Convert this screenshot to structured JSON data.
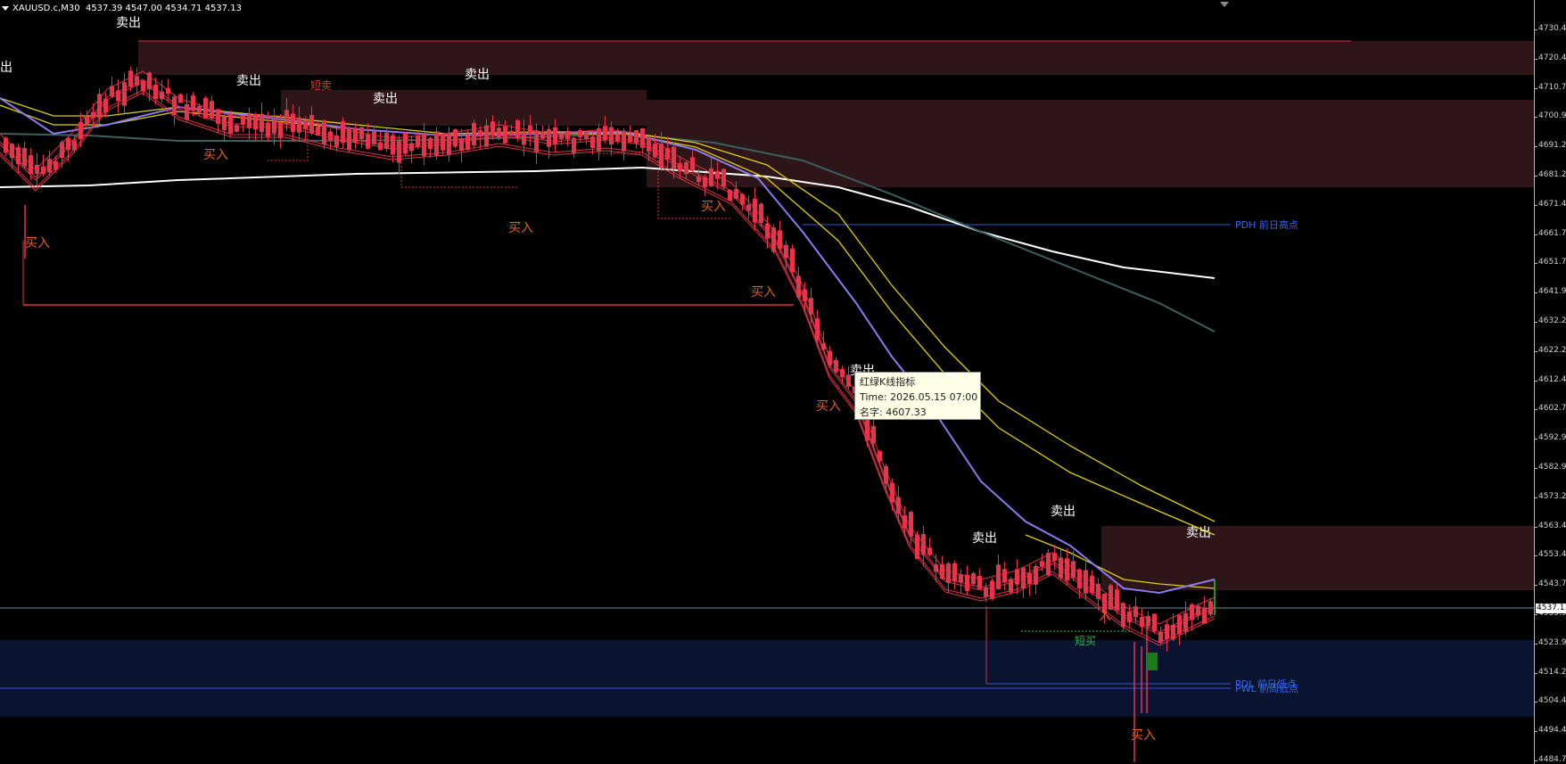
{
  "symbol": {
    "name": "XAUUSD.c,M30",
    "open": "4537.39",
    "high": "4547.00",
    "low": "4534.71",
    "close": "4537.13"
  },
  "price_axis": {
    "labels": [
      "4730.45",
      "4720.45",
      "4710.70",
      "4700.95",
      "4691.20",
      "4681.20",
      "4671.45",
      "4661.70",
      "4651.70",
      "4641.95",
      "4632.20",
      "4622.20",
      "4612.45",
      "4602.70",
      "4592.95",
      "4582.95",
      "4573.20",
      "4563.45",
      "4553.45",
      "4543.70",
      "4533.95",
      "4523.95",
      "4514.20",
      "4504.45",
      "4494.45",
      "4484.70"
    ],
    "current_price": "4537.13"
  },
  "levels": {
    "pdh_label": "PDH 前日高点",
    "pdl_label": "PDL 前日低点",
    "pwl_label": "PWL 前周低点"
  },
  "signals": {
    "sell": "卖出",
    "sell_partial": "出",
    "buy": "买入",
    "short_sell": "短卖",
    "short_buy": "短买",
    "buy_partial": "买",
    "buy_partial_2": "入"
  },
  "tooltip": {
    "title": "红绿K线指标",
    "time_label": "Time: 2026.05.15 07:00",
    "value_label": "名字: 4607.33"
  },
  "colors": {
    "bear_candle": "#e8334a",
    "bull_candle": "#1a7a1a",
    "sell_zone": "#2e1618",
    "buy_zone": "#0a1430",
    "level_line": "#3355dd",
    "ma_white": "#ffffff",
    "ma_teal": "#3c6060",
    "ma_yellow": "#e0d000",
    "ma_purple": "#8a7af0",
    "ma_red": "#e03040",
    "sell_text": "#ffffff",
    "buy_text": "#e06020",
    "short_sell_text": "#e04030",
    "short_buy_text": "#20c040"
  }
}
